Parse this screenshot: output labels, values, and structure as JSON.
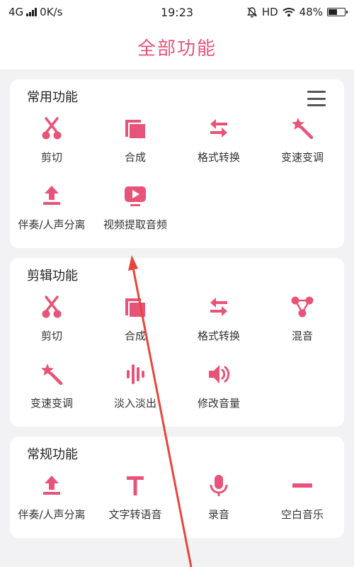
{
  "status": {
    "network": "4G",
    "speed": "0K/s",
    "time": "19:23",
    "hd": "HD",
    "battery": "48%"
  },
  "header": {
    "title": "全部功能"
  },
  "colors": {
    "accent": "#e85479",
    "annotation": "#e8453c"
  },
  "sections": [
    {
      "title": "常用功能",
      "items": [
        {
          "label": "剪切",
          "icon": "scissors-icon"
        },
        {
          "label": "合成",
          "icon": "merge-icon"
        },
        {
          "label": "格式转换",
          "icon": "convert-icon"
        },
        {
          "label": "变速变调",
          "icon": "magic-wand-icon"
        },
        {
          "label": "伴奏/人声分离",
          "icon": "upload-icon"
        },
        {
          "label": "视频提取音频",
          "icon": "video-play-icon"
        }
      ]
    },
    {
      "title": "剪辑功能",
      "items": [
        {
          "label": "剪切",
          "icon": "scissors-icon"
        },
        {
          "label": "合成",
          "icon": "merge-icon"
        },
        {
          "label": "格式转换",
          "icon": "convert-icon"
        },
        {
          "label": "混音",
          "icon": "mix-icon"
        },
        {
          "label": "变速变调",
          "icon": "magic-wand-icon"
        },
        {
          "label": "淡入淡出",
          "icon": "waveform-icon"
        },
        {
          "label": "修改音量",
          "icon": "volume-icon"
        }
      ]
    },
    {
      "title": "常规功能",
      "items": [
        {
          "label": "伴奏/人声分离",
          "icon": "upload-icon"
        },
        {
          "label": "文字转语音",
          "icon": "text-icon"
        },
        {
          "label": "录音",
          "icon": "microphone-icon"
        },
        {
          "label": "空白音乐",
          "icon": "minus-icon"
        }
      ]
    }
  ]
}
